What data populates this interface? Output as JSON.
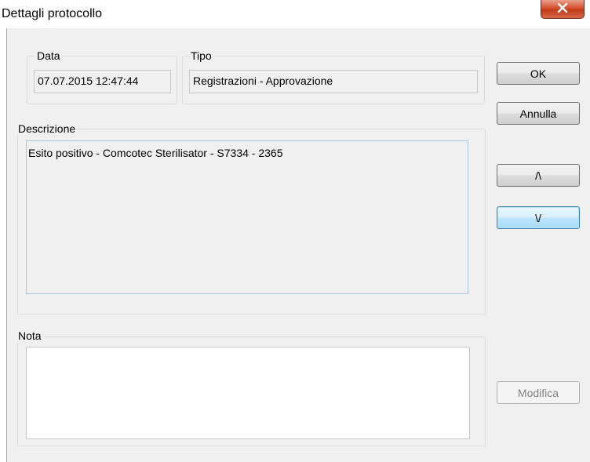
{
  "window": {
    "title": "Dettagli protocollo",
    "close_label": "X"
  },
  "data_group": {
    "label": "Data",
    "value": "07.07.2015 12:47:44"
  },
  "tipo_group": {
    "label": "Tipo",
    "value": "Registrazioni - Approvazione"
  },
  "descrizione_group": {
    "label": "Descrizione",
    "value": "Esito positivo - Comcotec Sterilisator - S7334 - 2365"
  },
  "nota_group": {
    "label": "Nota",
    "value": ""
  },
  "buttons": {
    "ok": "OK",
    "annulla": "Annulla",
    "up": "/\\",
    "down": "\\/",
    "modifica": "Modifica"
  }
}
